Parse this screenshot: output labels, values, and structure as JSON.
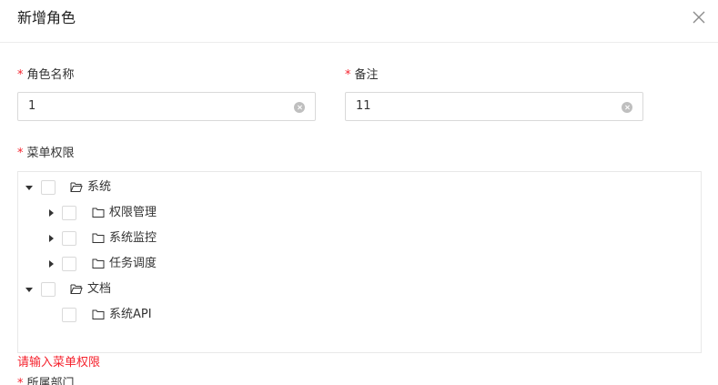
{
  "modal": {
    "title": "新增角色"
  },
  "form": {
    "role_name": {
      "label": "角色名称",
      "required_mark": "*",
      "value": "1"
    },
    "remark": {
      "label": "备注",
      "required_mark": "*",
      "value": "11"
    },
    "menu_perm": {
      "label": "菜单权限",
      "required_mark": "*",
      "error": "请输入菜单权限"
    },
    "department": {
      "label": "所属部门",
      "required_mark": "*"
    }
  },
  "tree": [
    {
      "label": "系统",
      "expanded": true,
      "folder": "open"
    },
    {
      "label": "权限管理",
      "expanded": false,
      "folder": "closed"
    },
    {
      "label": "系统监控",
      "expanded": false,
      "folder": "closed"
    },
    {
      "label": "任务调度",
      "expanded": false,
      "folder": "closed"
    },
    {
      "label": "文档",
      "expanded": true,
      "folder": "open"
    },
    {
      "label": "系统API",
      "expanded": null,
      "folder": "closed"
    }
  ],
  "colors": {
    "required": "#f5222d",
    "border": "#d9d9d9"
  }
}
